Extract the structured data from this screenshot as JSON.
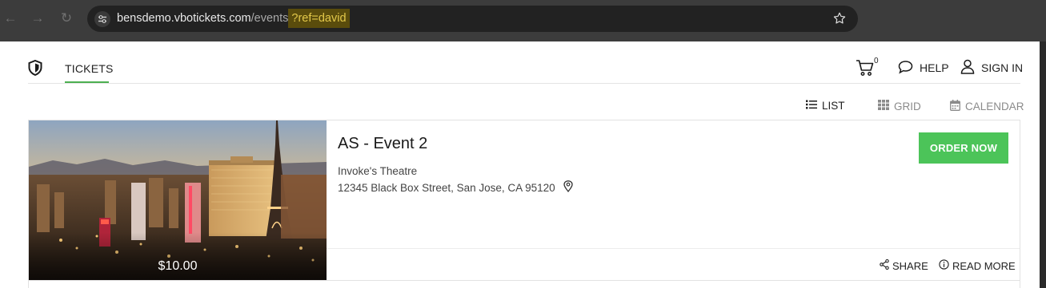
{
  "browser": {
    "url_host": "bensdemo.vbotickets.com",
    "url_path": "/events",
    "url_query": "?ref=david"
  },
  "header": {
    "nav_tickets": "TICKETS",
    "cart_count": "0",
    "help_label": "HELP",
    "signin_label": "SIGN IN"
  },
  "views": {
    "list": "LIST",
    "grid": "GRID",
    "calendar": "CALENDAR",
    "active": "LIST"
  },
  "event": {
    "title": "AS - Event 2",
    "venue": "Invoke's Theatre",
    "address": "12345 Black Box Street, San Jose, CA 95120",
    "price": "$10.00",
    "order_label": "ORDER NOW",
    "share_label": "SHARE",
    "read_more_label": "READ MORE"
  },
  "colors": {
    "accent_green": "#4cc459",
    "tab_underline": "#4caf50",
    "query_highlight": "#e3c84a"
  }
}
